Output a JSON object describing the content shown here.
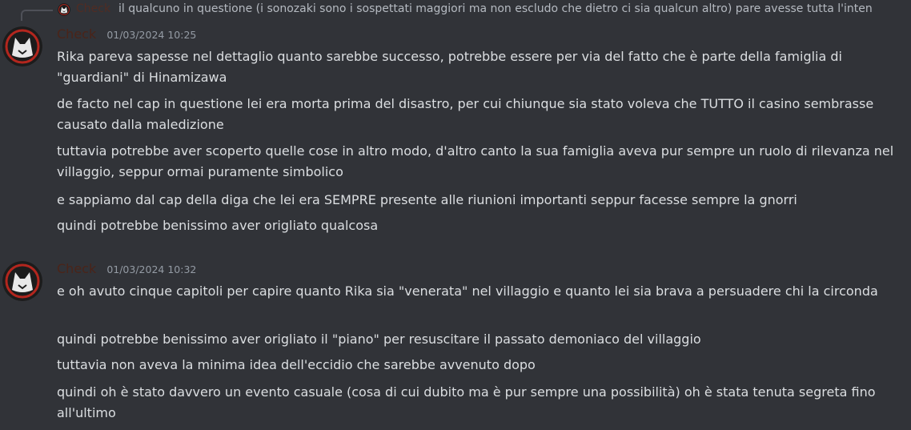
{
  "colors": {
    "background": "#313338",
    "text": "#dbdee1",
    "timestamp": "#949ba4",
    "author": "#4a2419",
    "reply_spine": "#4e5058"
  },
  "reply": {
    "author": "Check",
    "preview": "il qualcuno in questione (i sonozaki sono i sospettati maggiori ma non escludo che dietro ci sia qualcun altro) pare avesse tutta l'inten",
    "avatar_icon": "wolf-avatar-icon"
  },
  "messages": [
    {
      "author": "Check",
      "timestamp": "01/03/2024 10:25",
      "avatar_icon": "wolf-avatar-icon",
      "lines": [
        "Rika pareva sapesse nel dettaglio quanto sarebbe successo, potrebbe essere per via del fatto che è parte della famiglia di \"guardiani\" di Hinamizawa",
        "de facto nel cap in questione lei era morta prima del disastro, per cui chiunque sia stato voleva che TUTTO il casino sembrasse causato dalla maledizione",
        "tuttavia potrebbe aver scoperto quelle cose in altro modo, d'altro canto la sua famiglia aveva pur sempre un ruolo di rilevanza nel villaggio, seppur ormai puramente simbolico",
        "e sappiamo dal cap della diga che lei era SEMPRE presente alle riunioni importanti seppur facesse sempre la gnorri",
        "quindi potrebbe benissimo aver origliato qualcosa"
      ]
    },
    {
      "author": "Check",
      "timestamp": "01/03/2024 10:32",
      "avatar_icon": "wolf-avatar-icon",
      "lines": [
        "e oh avuto cinque capitoli per capire quanto Rika sia \"venerata\" nel villaggio e quanto lei sia brava a persuadere chi la circonda",
        "quindi potrebbe benissimo aver origliato il \"piano\" per resuscitare il passato demoniaco del villaggio",
        "tuttavia non aveva la minima idea dell'eccidio che sarebbe avvenuto dopo",
        "quindi oh è stato davvero un evento casuale (cosa di cui dubito ma è pur sempre una possibilità) oh è stata tenuta segreta fino all'ultimo"
      ]
    }
  ]
}
